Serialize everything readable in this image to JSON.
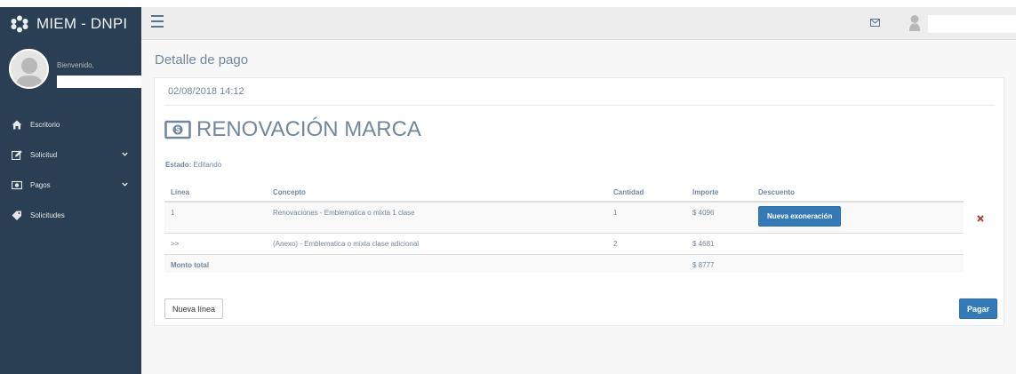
{
  "brand": {
    "title": "MIEM - DNPI",
    "logo_icon": "flower-logo-icon"
  },
  "topbar": {
    "menu_icon": "hamburger-icon",
    "mail_icon": "mail-icon",
    "user_icon": "user-icon"
  },
  "sidebar": {
    "welcome": "Bienvenido,",
    "items": [
      {
        "label": "Escritorio",
        "icon": "home-icon"
      },
      {
        "label": "Solicitud",
        "icon": "edit-icon",
        "has_submenu": true
      },
      {
        "label": "Pagos",
        "icon": "money-icon",
        "has_submenu": true
      },
      {
        "label": "Solicitudes",
        "icon": "tag-icon"
      }
    ]
  },
  "main": {
    "title": "Detalle de pago",
    "date": "02/08/2018 14:12",
    "heading": "RENOVACIÓN MARCA",
    "estado_label": "Estado:",
    "estado_value": "Editando",
    "table": {
      "headers": [
        "Línea",
        "Concepto",
        "Cantidad",
        "Importe",
        "Descuento"
      ],
      "rows": [
        {
          "linea": "1",
          "concepto": "Renovaciones - Emblematica o mixta 1 clase",
          "cantidad": "1",
          "importe": "$ 4096",
          "descuento_button": "Nueva exoneración"
        },
        {
          "linea": ">>",
          "concepto": "(Anexo) - Emblematica o mixta clase adicional",
          "cantidad": "2",
          "importe": "$ 4681"
        }
      ],
      "total_label": "Monto total",
      "total_value": "$ 8777"
    },
    "new_line_button": "Nueva línea",
    "pay_button": "Pagar"
  },
  "colors": {
    "sidebar": "#2a3f54",
    "primary_button": "#337ab7",
    "remove": "#a94442",
    "background": "#f7f7f7"
  }
}
